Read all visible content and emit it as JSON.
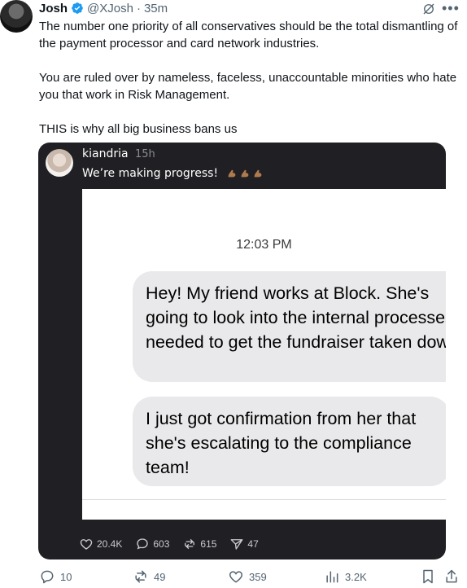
{
  "author": {
    "name": "Josh",
    "handle": "@XJosh",
    "separator": "·",
    "time": "35m"
  },
  "tweet": {
    "paragraphs": [
      "The number one priority of all conservatives should be the total dismantling of the payment processor and card network industries.",
      "You are ruled over by nameless, faceless, unaccountable minorities who hate you that work in Risk Management.",
      "THIS is why all big business bans us"
    ]
  },
  "embed": {
    "username": "kiandria",
    "time": "15h",
    "text": "We’re making progress!",
    "screenshot": {
      "time": "12:03 PM",
      "messages": [
        "Hey! My friend works at Block. She's going to look into the internal processes needed to get the fundraiser taken down",
        "I just got confirmation from her that she's escalating to the compliance team!"
      ]
    },
    "actions": {
      "likes": "20.4K",
      "comments": "603",
      "reposts": "615",
      "shares": "47"
    }
  },
  "actions": {
    "replies": "10",
    "reposts": "49",
    "likes": "359",
    "views": "3.2K"
  },
  "colors": {
    "verified": "#1d9bf0",
    "embed_bg": "#202024",
    "bubble": "#e9e9eb"
  }
}
